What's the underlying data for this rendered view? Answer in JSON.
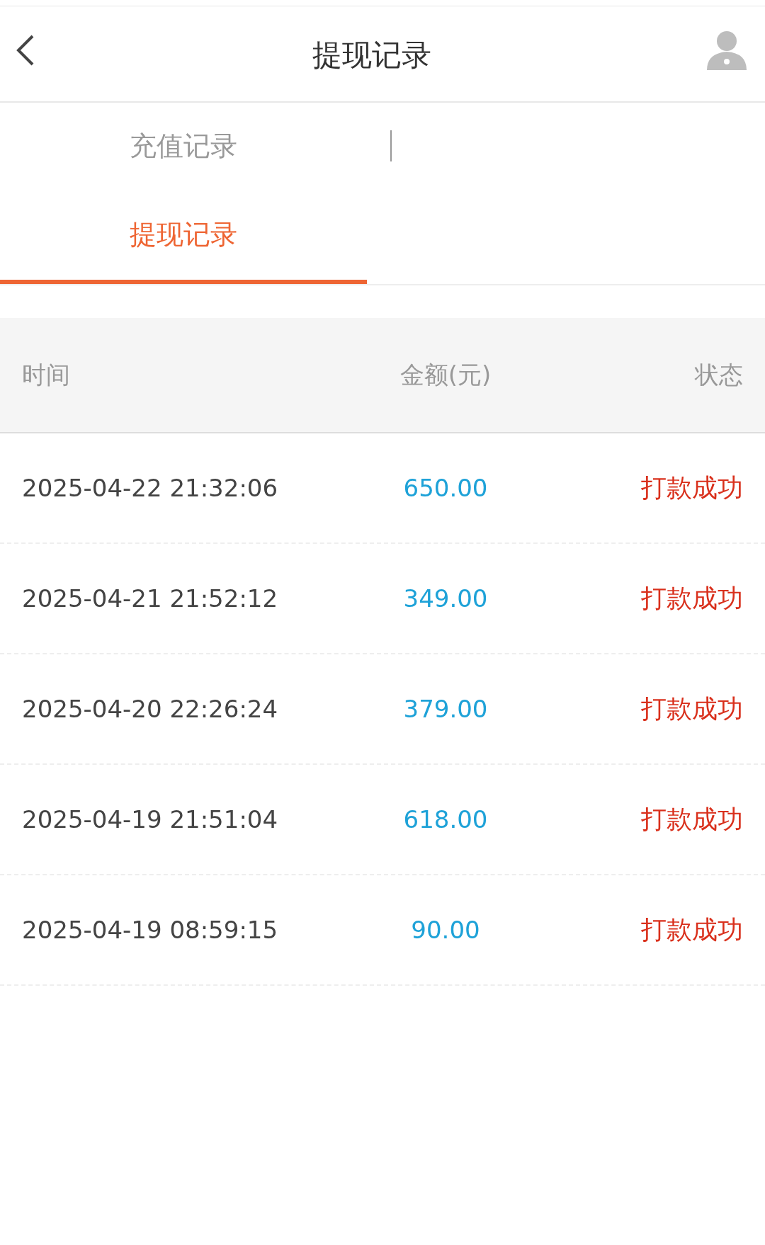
{
  "header": {
    "title": "提现记录"
  },
  "tabs": [
    {
      "label": "充值记录",
      "selected": false
    },
    {
      "label": "提现记录",
      "selected": true
    }
  ],
  "table": {
    "columns": [
      "时间",
      "金额(元)",
      "状态"
    ],
    "rows": [
      {
        "time": "2025-04-22 21:32:06",
        "amount": "650.00",
        "status": "打款成功"
      },
      {
        "time": "2025-04-21 21:52:12",
        "amount": "349.00",
        "status": "打款成功"
      },
      {
        "time": "2025-04-20 22:26:24",
        "amount": "379.00",
        "status": "打款成功"
      },
      {
        "time": "2025-04-19 21:51:04",
        "amount": "618.00",
        "status": "打款成功"
      },
      {
        "time": "2025-04-19 08:59:15",
        "amount": "90.00",
        "status": "打款成功"
      }
    ]
  }
}
